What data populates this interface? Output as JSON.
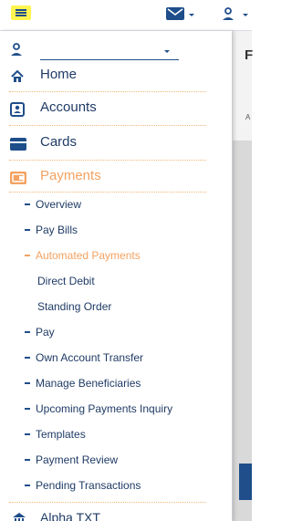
{
  "header": {
    "menu_icon": "hamburger-icon",
    "mail_icon": "mail-icon",
    "user_icon": "user-icon"
  },
  "drawer": {
    "user_select_value": "",
    "items": [
      {
        "label": "Home",
        "icon": "home-icon"
      },
      {
        "label": "Accounts",
        "icon": "accounts-icon"
      },
      {
        "label": "Cards",
        "icon": "card-icon"
      },
      {
        "label": "Payments",
        "icon": "payments-icon",
        "active": true
      }
    ],
    "payments_sub": [
      {
        "label": "Overview"
      },
      {
        "label": "Pay Bills"
      },
      {
        "label": "Automated Payments",
        "active": true
      },
      {
        "label": "Direct Debit",
        "level": 2
      },
      {
        "label": "Standing Order",
        "level": 2
      },
      {
        "label": "Pay"
      },
      {
        "label": "Own Account Transfer"
      },
      {
        "label": "Manage Beneficiaries"
      },
      {
        "label": "Upcoming Payments Inquiry"
      },
      {
        "label": "Templates"
      },
      {
        "label": "Payment Review"
      },
      {
        "label": "Pending Transactions"
      }
    ],
    "bottom_item": {
      "label": "Alpha TXT",
      "icon": "building-icon"
    }
  },
  "background": {
    "heading_letter": "F",
    "small_text": "A"
  },
  "colors": {
    "primary": "#1f3b66",
    "accent": "#f4a261",
    "highlight": "#fff44f"
  }
}
